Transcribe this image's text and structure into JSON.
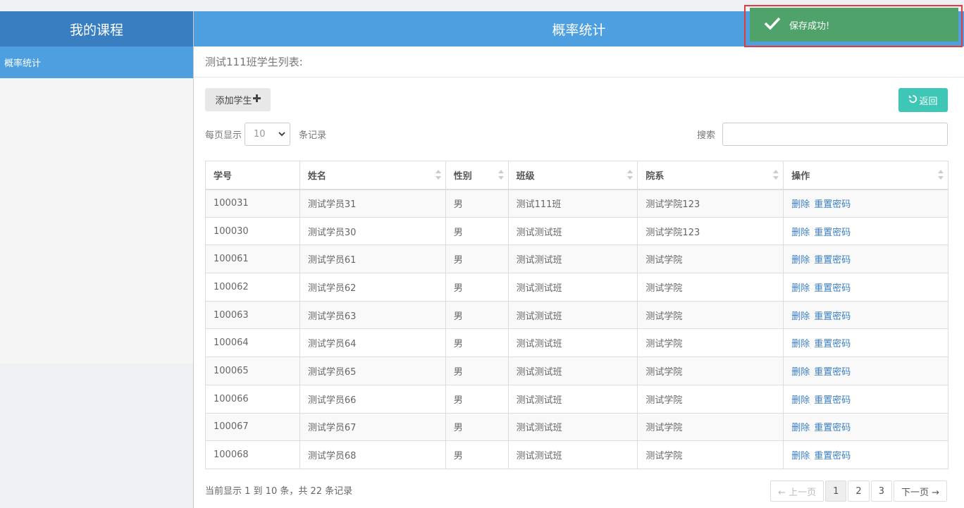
{
  "sidebar": {
    "title": "我的课程",
    "items": [
      {
        "label": "概率统计"
      }
    ]
  },
  "header": {
    "title": "概率统计"
  },
  "panel": {
    "heading": "测试111班学生列表:"
  },
  "toolbar": {
    "add_label": "添加学生",
    "back_label": "返回"
  },
  "length": {
    "prefix": "每页显示",
    "value": "10",
    "suffix": "条记录"
  },
  "search": {
    "label": "搜索",
    "value": ""
  },
  "table": {
    "columns": [
      "学号",
      "姓名",
      "性别",
      "班级",
      "院系",
      "操作"
    ],
    "rows": [
      [
        "100031",
        "测试学员31",
        "男",
        "测试111班",
        "测试学院123"
      ],
      [
        "100030",
        "测试学员30",
        "男",
        "测试测试班",
        "测试学院123"
      ],
      [
        "100061",
        "测试学员61",
        "男",
        "测试测试班",
        "测试学院"
      ],
      [
        "100062",
        "测试学员62",
        "男",
        "测试测试班",
        "测试学院"
      ],
      [
        "100063",
        "测试学员63",
        "男",
        "测试测试班",
        "测试学院"
      ],
      [
        "100064",
        "测试学员64",
        "男",
        "测试测试班",
        "测试学院"
      ],
      [
        "100065",
        "测试学员65",
        "男",
        "测试测试班",
        "测试学院"
      ],
      [
        "100066",
        "测试学员66",
        "男",
        "测试测试班",
        "测试学院"
      ],
      [
        "100067",
        "测试学员67",
        "男",
        "测试测试班",
        "测试学院"
      ],
      [
        "100068",
        "测试学员68",
        "男",
        "测试测试班",
        "测试学院"
      ]
    ],
    "actions": {
      "delete": "删除",
      "reset": "重置密码"
    }
  },
  "footer": {
    "info": "当前显示 1 到 10 条，共 22 条记录",
    "prev": "← 上一页",
    "pages": [
      "1",
      "2",
      "3"
    ],
    "next": "下一页 →"
  },
  "toast": {
    "message": "保存成功!"
  },
  "colors": {
    "sidebar_header": "#3a7ec2",
    "accent_blue": "#4e9fe0",
    "back_button": "#3ec6b6",
    "toast_bg": "#4fa36a",
    "highlight_border": "#e53a3a",
    "link": "#3a7ec2"
  }
}
